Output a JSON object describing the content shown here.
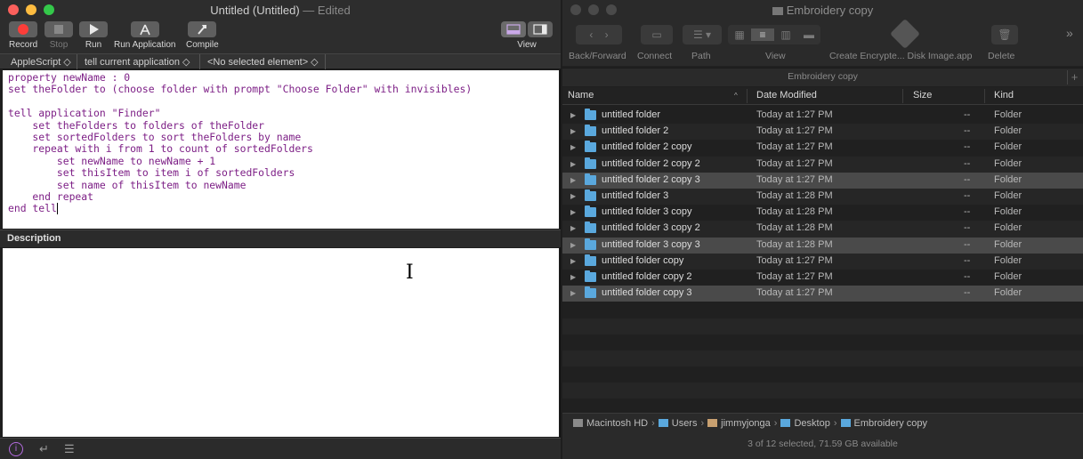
{
  "script_editor": {
    "title": "Untitled (Untitled)",
    "edited": "— Edited",
    "toolbar": {
      "record": "Record",
      "stop": "Stop",
      "run": "Run",
      "run_application": "Run Application",
      "compile": "Compile",
      "view": "View"
    },
    "navigation": {
      "language": "AppleScript ◇",
      "target": "tell current application ◇",
      "element": "<No selected element> ◇"
    },
    "code": "property newName : 0\nset theFolder to (choose folder with prompt \"Choose Folder\" with invisibles)\n\ntell application \"Finder\"\n    set theFolders to folders of theFolder\n    set sortedFolders to sort theFolders by name\n    repeat with i from 1 to count of sortedFolders\n        set newName to newName + 1\n        set thisItem to item i of sortedFolders\n        set name of thisItem to newName\n    end repeat\nend tell",
    "description_header": "Description"
  },
  "finder": {
    "title": "Embroidery copy",
    "toolbar": {
      "back_forward": "Back/Forward",
      "connect": "Connect",
      "path": "Path",
      "view": "View",
      "create_encrypted": "Create Encrypte... Disk Image.app",
      "delete": "Delete"
    },
    "path_label": "Embroidery copy",
    "columns": {
      "name": "Name",
      "date_modified": "Date Modified",
      "size": "Size",
      "kind": "Kind"
    },
    "rows": [
      {
        "name": "untitled folder",
        "date": "Today at 1:27 PM",
        "size": "--",
        "kind": "Folder"
      },
      {
        "name": "untitled folder 2",
        "date": "Today at 1:27 PM",
        "size": "--",
        "kind": "Folder"
      },
      {
        "name": "untitled folder 2 copy",
        "date": "Today at 1:27 PM",
        "size": "--",
        "kind": "Folder"
      },
      {
        "name": "untitled folder 2 copy 2",
        "date": "Today at 1:27 PM",
        "size": "--",
        "kind": "Folder"
      },
      {
        "name": "untitled folder 2 copy 3",
        "date": "Today at 1:27 PM",
        "size": "--",
        "kind": "Folder"
      },
      {
        "name": "untitled folder 3",
        "date": "Today at 1:28 PM",
        "size": "--",
        "kind": "Folder"
      },
      {
        "name": "untitled folder 3 copy",
        "date": "Today at 1:28 PM",
        "size": "--",
        "kind": "Folder"
      },
      {
        "name": "untitled folder 3 copy 2",
        "date": "Today at 1:28 PM",
        "size": "--",
        "kind": "Folder"
      },
      {
        "name": "untitled folder 3 copy 3",
        "date": "Today at 1:28 PM",
        "size": "--",
        "kind": "Folder"
      },
      {
        "name": "untitled folder copy",
        "date": "Today at 1:27 PM",
        "size": "--",
        "kind": "Folder"
      },
      {
        "name": "untitled folder copy 2",
        "date": "Today at 1:27 PM",
        "size": "--",
        "kind": "Folder"
      },
      {
        "name": "untitled folder copy 3",
        "date": "Today at 1:27 PM",
        "size": "--",
        "kind": "Folder"
      }
    ],
    "path_bar": [
      "Macintosh HD",
      "Users",
      "jimmyjonga",
      "Desktop",
      "Embroidery copy"
    ],
    "status": "3 of 12 selected, 71.59 GB available"
  }
}
